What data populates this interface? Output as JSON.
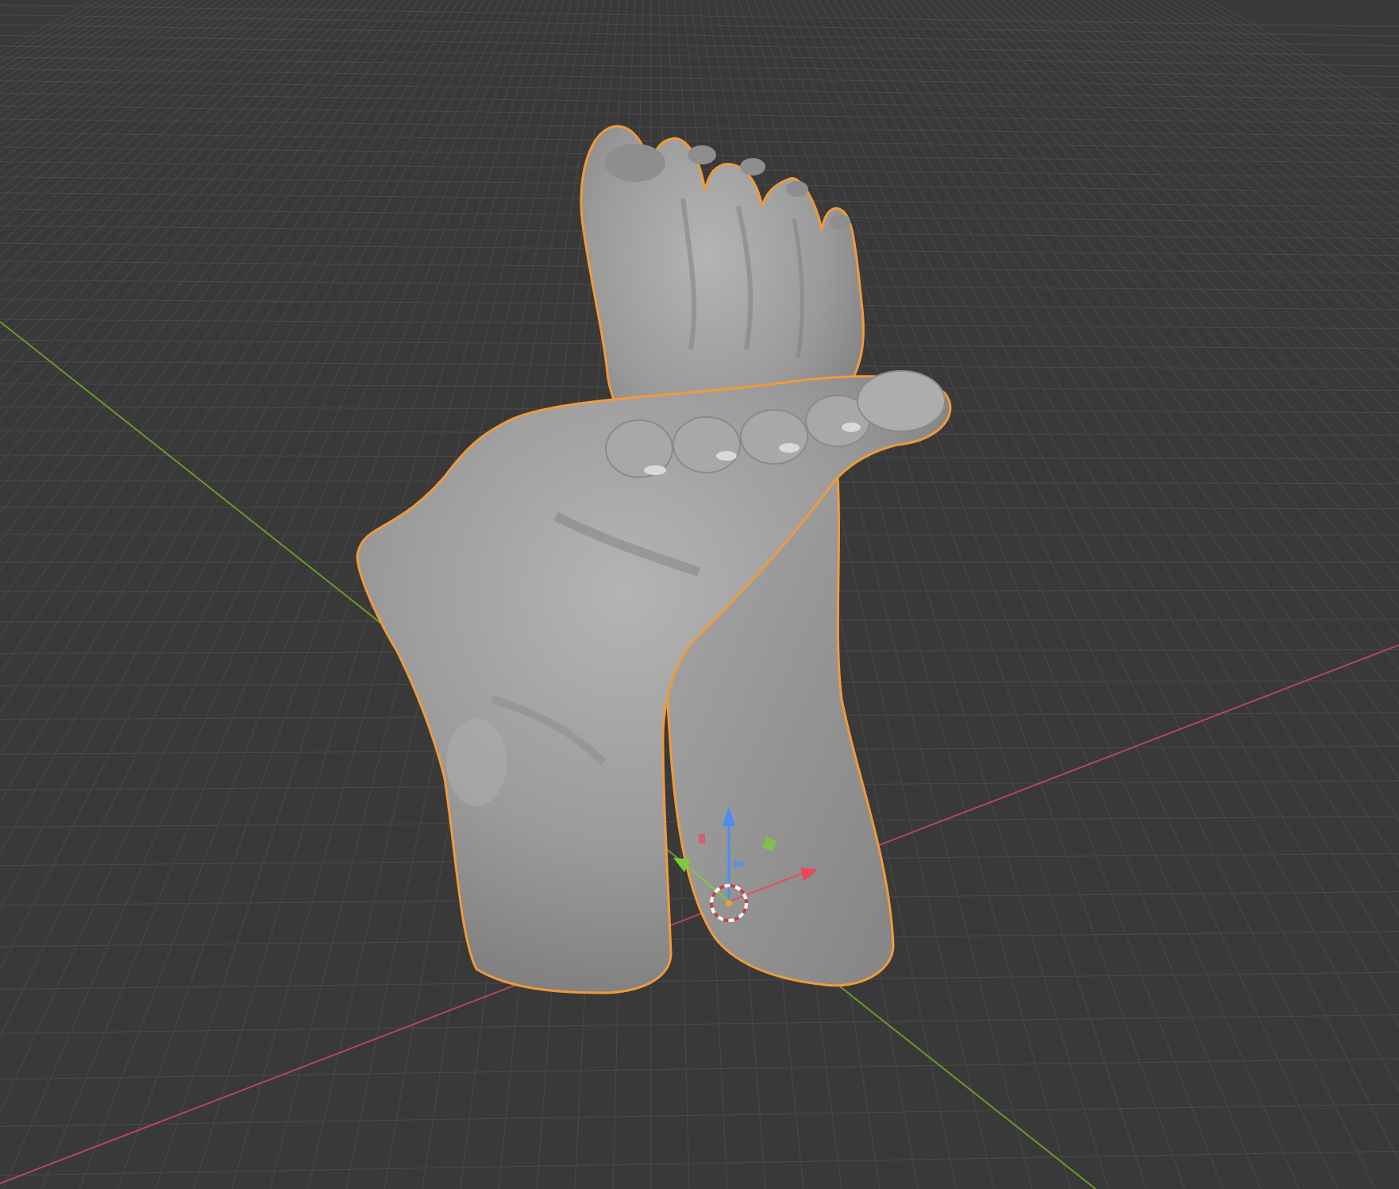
{
  "viewport": {
    "mode": "3d-viewport",
    "shading": "solid",
    "background_color": "#393939",
    "grid_color": "#4a4a4a",
    "grid_color_major": "#525252",
    "x_axis_color": "#b0485a",
    "y_axis_color": "#6a9a2a"
  },
  "object": {
    "type": "mesh",
    "subject": "sculpted feet",
    "selected": true,
    "active": true,
    "outline_color": "#f09a3c",
    "surface_color": "#9c9c9c"
  },
  "gizmo": {
    "type": "move-transform-gizmo",
    "x_color": "#e84a5a",
    "y_color": "#7ccc3a",
    "z_color": "#4a8ff0",
    "origin_icon": "3d-cursor-icon"
  }
}
